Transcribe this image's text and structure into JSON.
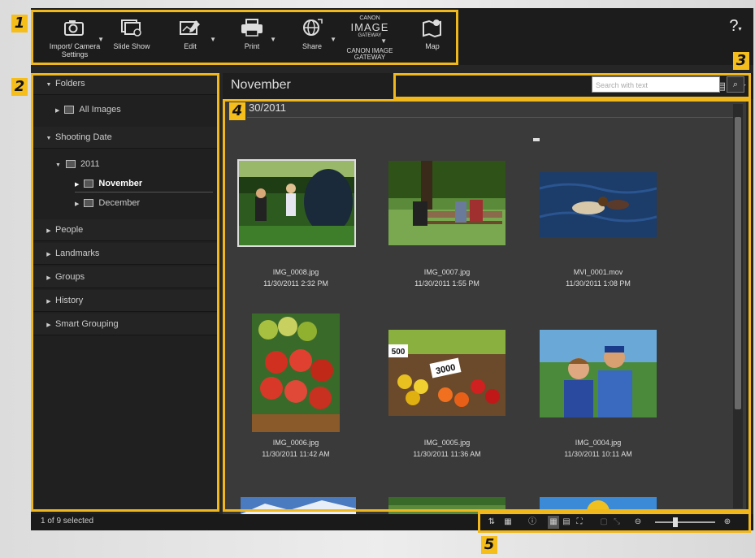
{
  "toolbar": {
    "buttons": [
      {
        "label": "Import/ Camera Settings",
        "icon": "camera-import-icon"
      },
      {
        "label": "Slide Show",
        "icon": "slideshow-icon"
      },
      {
        "label": "Edit",
        "icon": "edit-icon"
      },
      {
        "label": "Print",
        "icon": "printer-icon"
      },
      {
        "label": "Share",
        "icon": "globe-share-icon"
      },
      {
        "label": "CANON IMAGE GATEWAY",
        "icon": "canon-image-gateway-logo"
      },
      {
        "label": "Map",
        "icon": "map-icon"
      }
    ],
    "gateway_logo_top": "CANON",
    "gateway_logo_main": "IMAGE",
    "gateway_logo_sub": "GATEWAY",
    "help": "?"
  },
  "sidebar": {
    "folders": "Folders",
    "all_images": "All Images",
    "shooting_date": "Shooting Date",
    "year": "2011",
    "months": [
      "November",
      "December"
    ],
    "people": "People",
    "landmarks": "Landmarks",
    "groups": "Groups",
    "history": "History",
    "smart_grouping": "Smart Grouping"
  },
  "main": {
    "title": "November",
    "date_header": "30/2011",
    "search_placeholder": "Search with text",
    "images": [
      {
        "name": "IMG_0008.jpg",
        "date": "11/30/2011 2:32 PM"
      },
      {
        "name": "IMG_0007.jpg",
        "date": "11/30/2011 1:55 PM"
      },
      {
        "name": "MVI_0001.mov",
        "date": "11/30/2011 1:08 PM"
      },
      {
        "name": "IMG_0006.jpg",
        "date": "11/30/2011 11:42 AM"
      },
      {
        "name": "IMG_0005.jpg",
        "date": "11/30/2011 11:36 AM"
      },
      {
        "name": "IMG_0004.jpg",
        "date": "11/30/2011 10:11 AM"
      }
    ],
    "sign_500": "500",
    "sign_3000": "3000"
  },
  "status": {
    "text": "1 of 9 selected"
  },
  "callouts": [
    "1",
    "2",
    "3",
    "4",
    "5"
  ],
  "colors": {
    "callout": "#f0b81c",
    "background": "#262626"
  }
}
